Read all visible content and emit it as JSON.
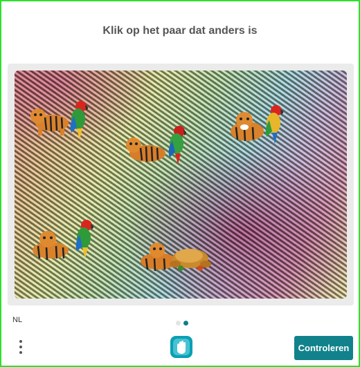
{
  "header": {
    "title": "Klik op het paar dat anders is"
  },
  "footer": {
    "language": "NL",
    "submit_label": "Controleren",
    "pages": 2,
    "current_page": 2
  },
  "challenge": {
    "pairs": [
      {
        "kind": "tiger-parrot"
      },
      {
        "kind": "tiger-parrot"
      },
      {
        "kind": "tiger-parrot"
      },
      {
        "kind": "tiger-parrot"
      },
      {
        "kind": "tiger-food"
      }
    ]
  },
  "colors": {
    "accent": "#11828b",
    "frame": "#2ee02e",
    "title": "#555555"
  }
}
